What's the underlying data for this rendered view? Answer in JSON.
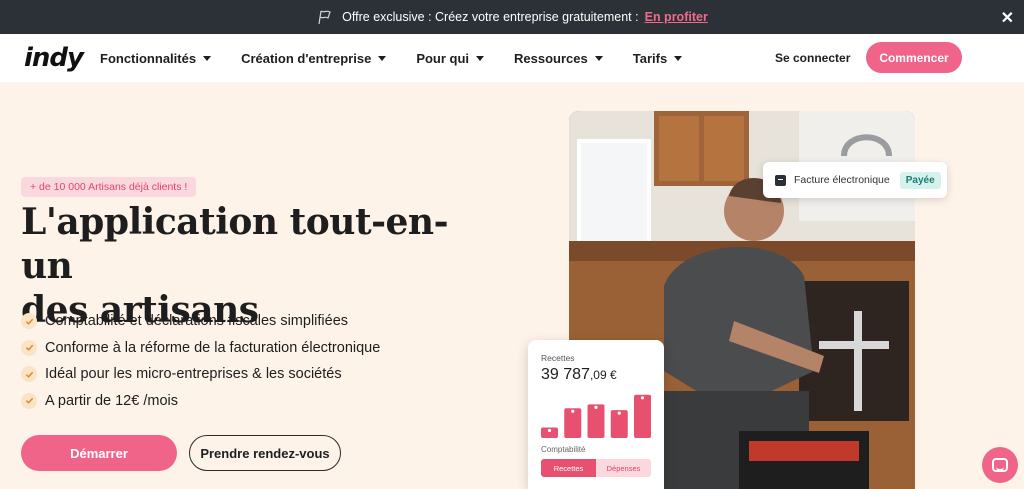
{
  "announcement": {
    "text": "Offre exclusive : Créez votre entreprise gratuitement :",
    "link": "En profiter",
    "close_icon": "close-icon"
  },
  "nav": {
    "logo": "indy",
    "menu": [
      {
        "label": "Fonctionnalités"
      },
      {
        "label": "Création d'entreprise"
      },
      {
        "label": "Pour qui"
      },
      {
        "label": "Ressources"
      },
      {
        "label": "Tarifs"
      }
    ],
    "login": "Se connecter",
    "cta": "Commencer"
  },
  "hero": {
    "badge": "+ de 10 000 Artisans déjà clients !",
    "headline_line1": "L'application tout-en-un",
    "headline_line2": "des artisans",
    "features": [
      "Comptabilité et déclarations fiscales simplifiées",
      "Conforme à la réforme de la facturation électronique",
      "Idéal pour les micro-entreprises & les sociétés",
      "A partir de 12€ /mois"
    ],
    "primary_button": "Démarrer",
    "secondary_button": "Prendre rendez-vous"
  },
  "invoice_chip": {
    "label": "Facture électronique",
    "status": "Payée"
  },
  "revenue_card": {
    "label": "Recettes",
    "amount_main": "39 787",
    "amount_decimals": ",09 €",
    "bar_levels": [
      0.22,
      0.62,
      0.7,
      0.58,
      0.9
    ],
    "section_label": "Comptabilité",
    "tabs": [
      "Recettes",
      "Dépenses"
    ],
    "active_tab": "Recettes"
  },
  "colors": {
    "brand_pink": "#f0648a",
    "topbar_bg": "#2b3137",
    "page_bg": "#fdf3e9"
  }
}
